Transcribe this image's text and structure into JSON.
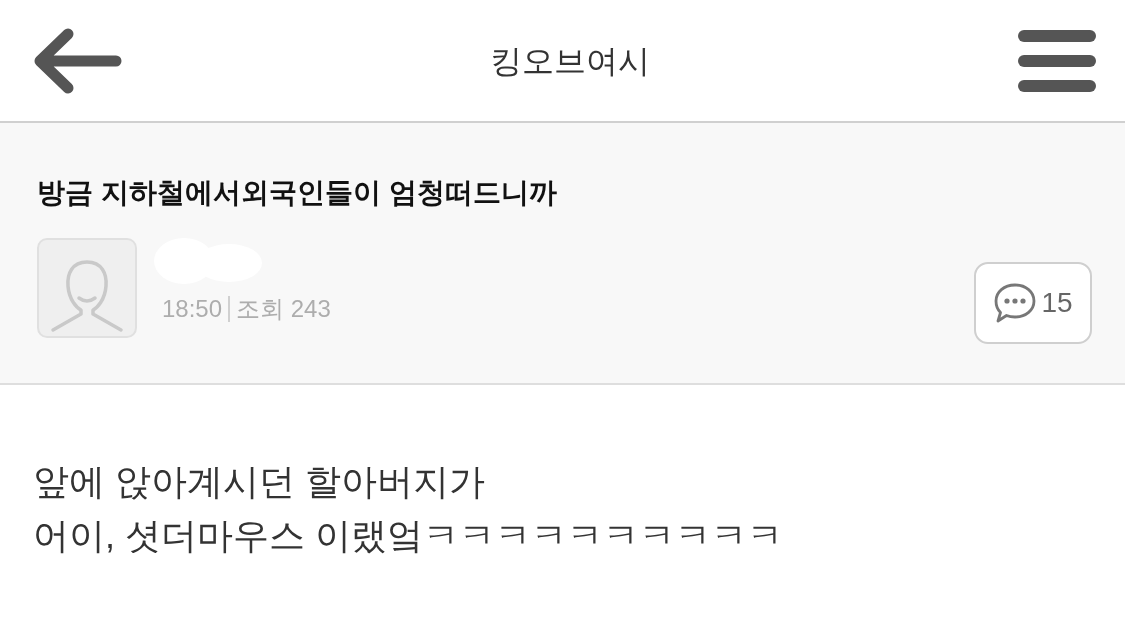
{
  "header": {
    "title": "킹오브여시"
  },
  "post": {
    "title": "방금 지하철에서외국인들이 엄청떠드니까",
    "time": "18:50",
    "views": "조회 243",
    "comment_count": "15"
  },
  "body": {
    "lines": [
      "앞에 앉아계시던 할아버지가",
      "어이, 셧더마우스 이랬엌ㅋㅋㅋㅋㅋㅋㅋㅋㅋㅋ"
    ]
  }
}
